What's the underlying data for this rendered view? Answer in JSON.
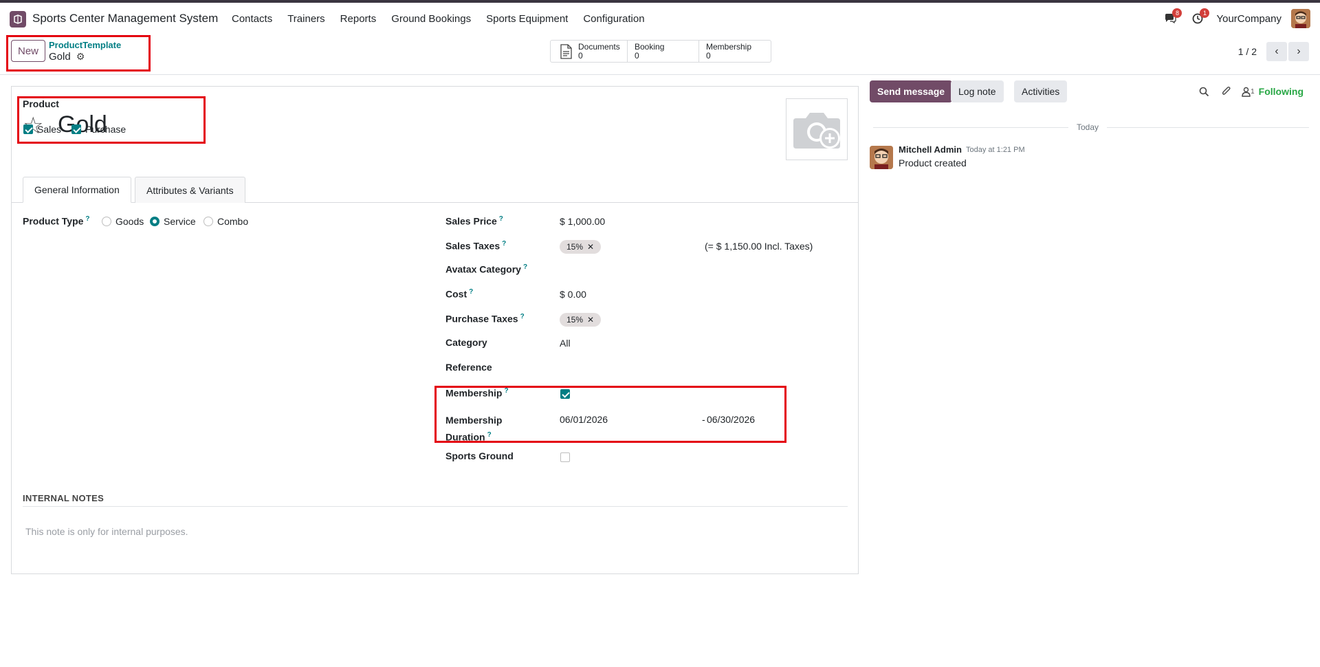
{
  "navbar": {
    "app_name": "Sports Center Management System",
    "menu": [
      "Contacts",
      "Trainers",
      "Reports",
      "Ground Bookings",
      "Sports Equipment",
      "Configuration"
    ],
    "messages_badge": "8",
    "activities_badge": "1",
    "company": "YourCompany"
  },
  "control": {
    "new_label": "New",
    "breadcrumb_parent": "ProductTemplate",
    "breadcrumb_current": "Gold",
    "smart_buttons": [
      {
        "label": "Documents",
        "count": "0"
      },
      {
        "label": "Booking",
        "count": "0"
      },
      {
        "label": "Membership",
        "count": "0"
      }
    ],
    "pager": "1 / 2"
  },
  "form": {
    "product_label": "Product",
    "product_name": "Gold",
    "sales_label": "Sales",
    "sales_checked": true,
    "purchase_label": "Purchase",
    "purchase_checked": true,
    "tabs": [
      "General Information",
      "Attributes & Variants"
    ],
    "product_type_label": "Product Type",
    "product_type_options": [
      "Goods",
      "Service",
      "Combo"
    ],
    "product_type_selected": "Service",
    "sales_price_label": "Sales Price",
    "sales_price": "$ 1,000.00",
    "sales_taxes_label": "Sales Taxes",
    "sales_taxes_tag": "15%",
    "sales_taxes_incl": "(= $ 1,150.00 Incl. Taxes)",
    "avatax_label": "Avatax Category",
    "cost_label": "Cost",
    "cost": "$ 0.00",
    "purchase_taxes_label": "Purchase Taxes",
    "purchase_taxes_tag": "15%",
    "category_label": "Category",
    "category": "All",
    "reference_label": "Reference",
    "membership_label": "Membership",
    "membership_checked": true,
    "membership_duration_label_1": "Membership",
    "membership_duration_label_2": "Duration",
    "membership_start": "06/01/2026",
    "membership_end": "06/30/2026",
    "sports_ground_label": "Sports Ground",
    "sports_ground_checked": false,
    "internal_notes_title": "INTERNAL NOTES",
    "internal_notes_placeholder": "This note is only for internal purposes."
  },
  "chatter": {
    "send_message": "Send message",
    "log_note": "Log note",
    "activities": "Activities",
    "followers_count": "1",
    "following": "Following",
    "date_separator": "Today",
    "message_author": "Mitchell Admin",
    "message_time": "Today at 1:21 PM",
    "message_body": "Product created"
  },
  "colors": {
    "brand": "#714b67",
    "accent": "#017e84",
    "highlight_box": "#e4000f",
    "following": "#28a745"
  }
}
